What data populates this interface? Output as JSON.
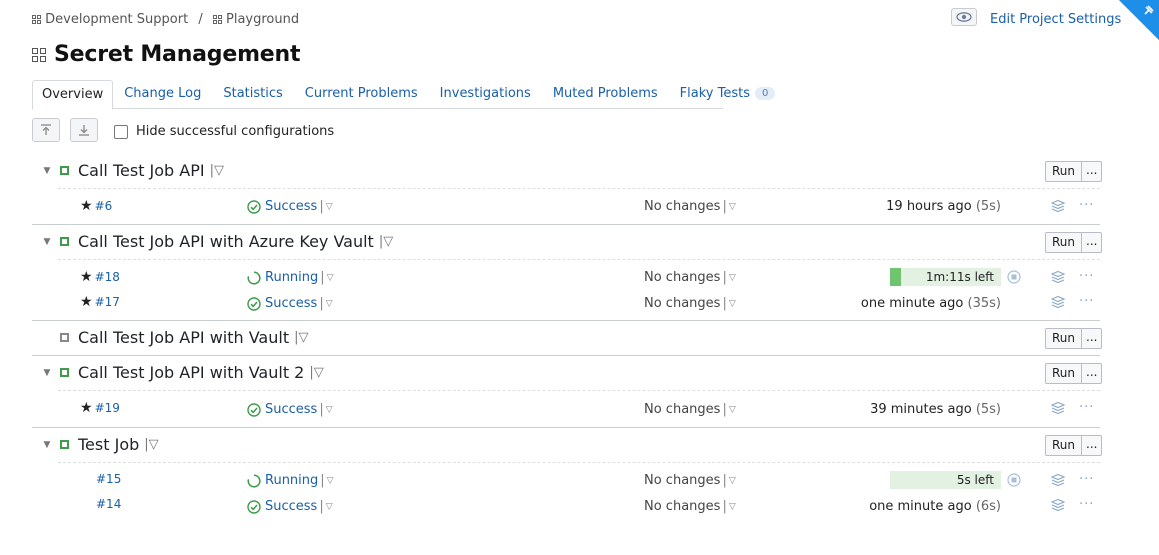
{
  "breadcrumb": {
    "items": [
      "Development Support",
      "Playground"
    ],
    "separator": "/"
  },
  "header": {
    "edit_settings": "Edit Project Settings"
  },
  "page": {
    "title": "Secret Management"
  },
  "tabs": [
    {
      "label": "Overview",
      "active": true
    },
    {
      "label": "Change Log"
    },
    {
      "label": "Statistics"
    },
    {
      "label": "Current Problems"
    },
    {
      "label": "Investigations"
    },
    {
      "label": "Muted Problems"
    },
    {
      "label": "Flaky Tests",
      "badge": "0"
    }
  ],
  "toolbar": {
    "hide_label": "Hide successful configurations",
    "hide_checked": false
  },
  "actions": {
    "run": "Run",
    "more": "..."
  },
  "configs": [
    {
      "name": "Call Test Job API",
      "builds": [
        {
          "number": "#6",
          "starred": true,
          "status": "Success",
          "changes": "No changes",
          "time": "19 hours ago",
          "duration": "(5s)"
        }
      ]
    },
    {
      "name": "Call Test Job API with Azure Key Vault",
      "builds": [
        {
          "number": "#18",
          "starred": true,
          "status": "Running",
          "changes": "No changes",
          "remaining": "1m:11s left",
          "progress": 0.1
        },
        {
          "number": "#17",
          "starred": true,
          "status": "Success",
          "changes": "No changes",
          "time": "one minute ago",
          "duration": "(35s)"
        }
      ]
    },
    {
      "name": "Call Test Job API with Vault",
      "builds": []
    },
    {
      "name": "Call Test Job API with Vault 2",
      "builds": [
        {
          "number": "#19",
          "starred": true,
          "status": "Success",
          "changes": "No changes",
          "time": "39 minutes ago",
          "duration": "(5s)"
        }
      ]
    },
    {
      "name": "Test Job",
      "builds": [
        {
          "number": "#15",
          "starred": false,
          "status": "Running",
          "changes": "No changes",
          "remaining": "5s left",
          "progress": 0.0
        },
        {
          "number": "#14",
          "starred": false,
          "status": "Success",
          "changes": "No changes",
          "time": "one minute ago",
          "duration": "(6s)"
        }
      ]
    }
  ],
  "colors": {
    "success": "#3d9b4b",
    "link": "#1a5fa8",
    "progress_fill": "#6fc46f",
    "progress_bg": "#e3f1e3"
  }
}
